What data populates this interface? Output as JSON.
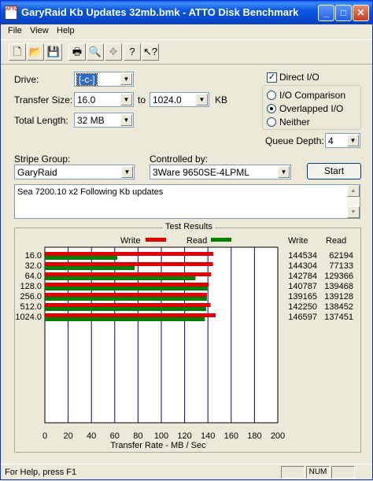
{
  "window": {
    "title": "GaryRaid Kb Updates 32mb.bmk - ATTO Disk Benchmark",
    "icon_text": "ATTO"
  },
  "menu": [
    "File",
    "View",
    "Help"
  ],
  "toolbar": [
    "new-icon",
    "open-icon",
    "save-icon",
    "print-icon",
    "print-preview-icon",
    "move-icon",
    "help-icon",
    "context-help-icon"
  ],
  "form": {
    "drive_label": "Drive:",
    "drive_value": "[-c-]",
    "transfer_size_label": "Transfer Size:",
    "transfer_from": "16.0",
    "to_label": "to",
    "transfer_to": "1024.0",
    "kb_label": "KB",
    "total_length_label": "Total Length:",
    "total_length_value": "32 MB",
    "direct_io_label": "Direct I/O",
    "direct_io_checked": true,
    "radio_io_comparison": "I/O Comparison",
    "radio_overlapped": "Overlapped I/O",
    "radio_neither": "Neither",
    "queue_depth_label": "Queue Depth:",
    "queue_depth_value": "4",
    "stripe_group_label": "Stripe Group:",
    "stripe_group_value": "GaryRaid",
    "controlled_by_label": "Controlled by:",
    "controlled_by_value": "3Ware 9650SE-4LPML",
    "start_button": "Start",
    "description": "Sea 7200.10 x2 Following Kb updates"
  },
  "results": {
    "title": "Test Results",
    "legend_write": "Write",
    "legend_read": "Read",
    "col_write": "Write",
    "col_read": "Read",
    "write_color": "#e00000",
    "read_color": "#008000"
  },
  "chart_data": {
    "type": "bar",
    "title": "Test Results",
    "xlabel": "Transfer Rate - MB / Sec",
    "xlim": [
      0,
      200
    ],
    "xticks": [
      0,
      20,
      40,
      60,
      80,
      100,
      120,
      140,
      160,
      180,
      200
    ],
    "categories": [
      "16.0",
      "32.0",
      "64.0",
      "128.0",
      "256.0",
      "512.0",
      "1024.0"
    ],
    "series": [
      {
        "name": "Write",
        "values": [
          144534,
          144304,
          142784,
          140787,
          139165,
          142250,
          146597
        ]
      },
      {
        "name": "Read",
        "values": [
          62194,
          77133,
          129366,
          139468,
          139128,
          138452,
          137451
        ]
      }
    ],
    "grid": true,
    "legend": "top"
  },
  "statusbar": {
    "text": "For Help, press F1",
    "num": "NUM"
  }
}
